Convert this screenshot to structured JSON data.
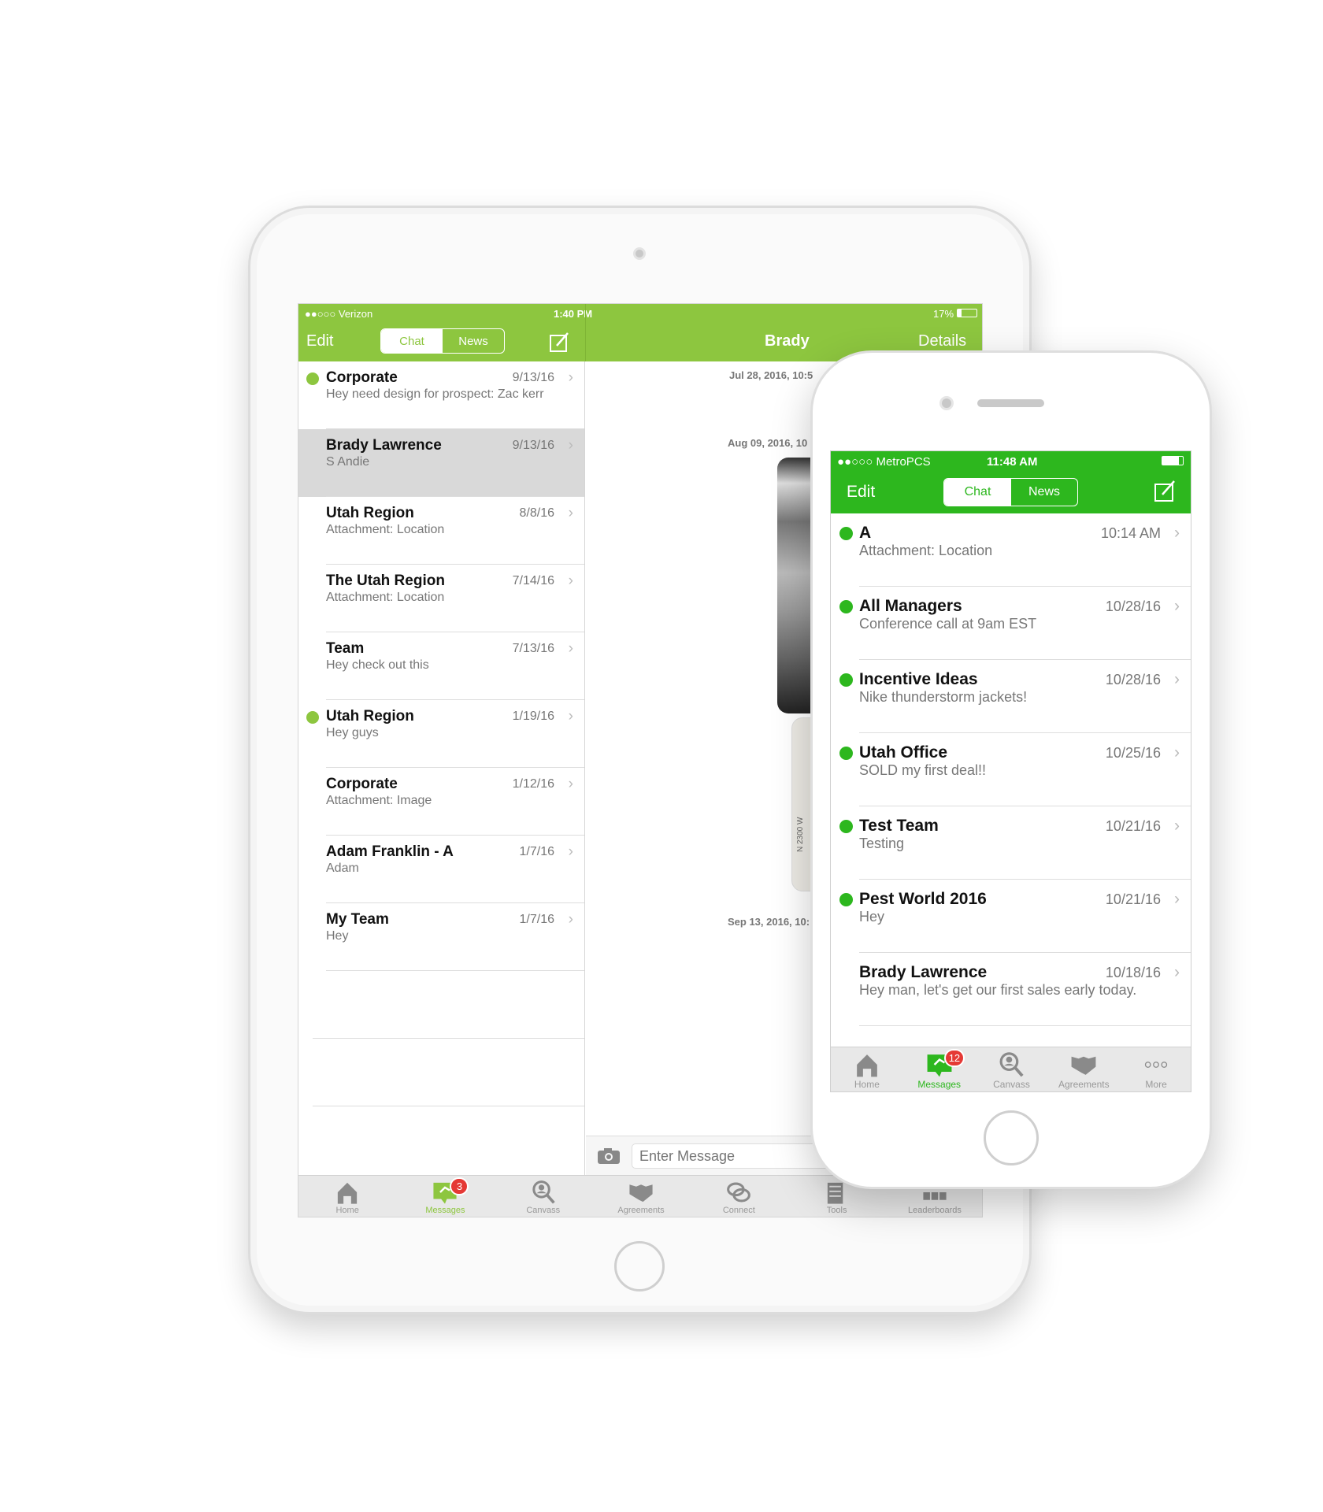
{
  "ipad": {
    "status": {
      "carrier": "●●○○○ Verizon",
      "time": "1:40 PM",
      "battery": "17%"
    },
    "nav": {
      "edit": "Edit",
      "tabs": [
        "Chat",
        "News"
      ],
      "active_tab": "Chat",
      "chat_title": "Brady",
      "details": "Details"
    },
    "accent": "#8dc63f",
    "conversations": [
      {
        "title": "Corporate",
        "subtitle": "Hey need design for prospect: Zac kerr",
        "date": "9/13/16",
        "unread": true,
        "selected": false
      },
      {
        "title": "Brady Lawrence",
        "subtitle": "S Andie",
        "date": "9/13/16",
        "unread": false,
        "selected": true
      },
      {
        "title": "Utah Region",
        "subtitle": "Attachment: Location",
        "date": "8/8/16",
        "unread": false,
        "selected": false
      },
      {
        "title": "The Utah Region",
        "subtitle": "Attachment: Location",
        "date": "7/14/16",
        "unread": false,
        "selected": false
      },
      {
        "title": "Team",
        "subtitle": "Hey check out this",
        "date": "7/13/16",
        "unread": false,
        "selected": false
      },
      {
        "title": "Utah Region",
        "subtitle": "Hey guys",
        "date": "1/19/16",
        "unread": true,
        "selected": false
      },
      {
        "title": "Corporate",
        "subtitle": "Attachment: Image",
        "date": "1/12/16",
        "unread": false,
        "selected": false
      },
      {
        "title": "Adam Franklin - A",
        "subtitle": "Adam",
        "date": "1/7/16",
        "unread": false,
        "selected": false
      },
      {
        "title": "My Team",
        "subtitle": "Hey",
        "date": "1/7/16",
        "unread": false,
        "selected": false
      }
    ],
    "chat": {
      "timestamps": [
        "Jul 28, 2016, 10:5",
        "Aug 09, 2016, 10",
        "Sep 13, 2016, 10:"
      ],
      "map_label": "N 2300 W",
      "input_placeholder": "Enter Message"
    },
    "tabbar": [
      {
        "label": "Home",
        "icon": "home-icon"
      },
      {
        "label": "Messages",
        "icon": "messages-icon",
        "badge": "3",
        "active": true
      },
      {
        "label": "Canvass",
        "icon": "canvass-icon"
      },
      {
        "label": "Agreements",
        "icon": "handshake-icon"
      },
      {
        "label": "Connect",
        "icon": "connect-icon"
      },
      {
        "label": "Tools",
        "icon": "tools-icon"
      },
      {
        "label": "Leaderboards",
        "icon": "leaderboards-icon"
      }
    ]
  },
  "iphone": {
    "status": {
      "carrier": "●●○○○ MetroPCS",
      "time": "11:48 AM"
    },
    "nav": {
      "edit": "Edit",
      "tabs": [
        "Chat",
        "News"
      ],
      "active_tab": "Chat"
    },
    "accent": "#2db71e",
    "conversations": [
      {
        "title": "A",
        "subtitle": "Attachment: Location",
        "date": "10:14 AM",
        "unread": true
      },
      {
        "title": "All Managers",
        "subtitle": "Conference call at 9am EST",
        "date": "10/28/16",
        "unread": true
      },
      {
        "title": "Incentive Ideas",
        "subtitle": "Nike thunderstorm jackets!",
        "date": "10/28/16",
        "unread": true
      },
      {
        "title": "Utah Office",
        "subtitle": "SOLD my first deal!!",
        "date": "10/25/16",
        "unread": true
      },
      {
        "title": "Test Team",
        "subtitle": "Testing",
        "date": "10/21/16",
        "unread": true
      },
      {
        "title": "Pest World 2016",
        "subtitle": "Hey",
        "date": "10/21/16",
        "unread": true
      },
      {
        "title": "Brady Lawrence",
        "subtitle": "Hey man, let's get our first sales early today.",
        "date": "10/18/16",
        "unread": false
      }
    ],
    "tabbar": [
      {
        "label": "Home",
        "icon": "home-icon"
      },
      {
        "label": "Messages",
        "icon": "messages-icon",
        "badge": "12",
        "active": true
      },
      {
        "label": "Canvass",
        "icon": "canvass-icon"
      },
      {
        "label": "Agreements",
        "icon": "handshake-icon"
      },
      {
        "label": "More",
        "icon": "more-icon"
      }
    ]
  }
}
